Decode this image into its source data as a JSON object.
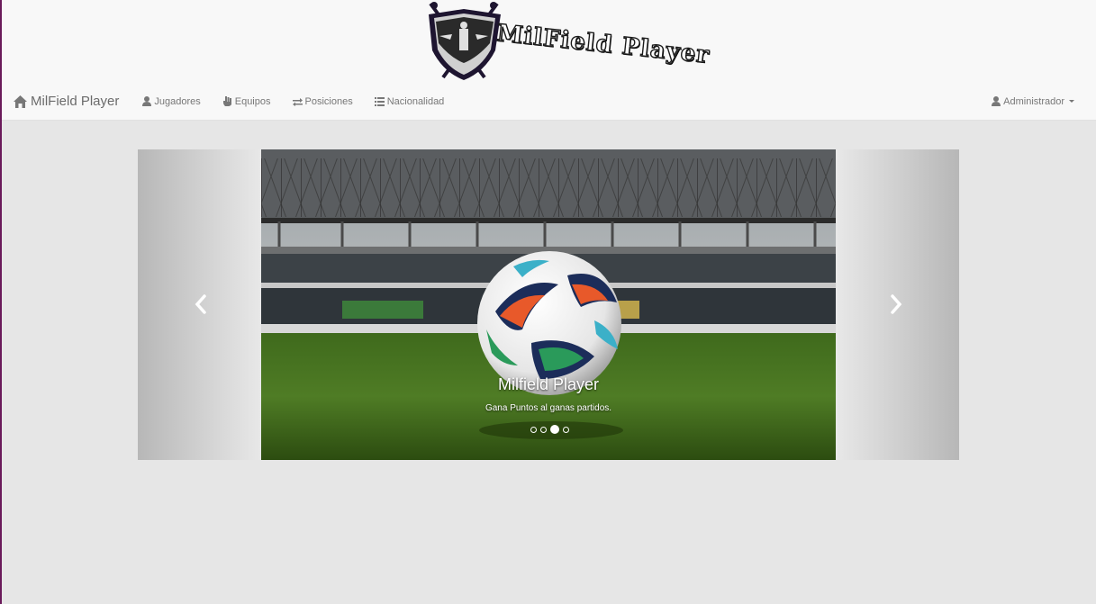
{
  "logo": {
    "text": "MilField Player",
    "shield_text": "MilField Player",
    "colors": {
      "shield": "#1e1530",
      "silver": "#c9c9c9"
    }
  },
  "navbar": {
    "brand": {
      "label": "MilField Player",
      "icon": "home-icon"
    },
    "items": [
      {
        "label": "Jugadores",
        "icon": "user-icon"
      },
      {
        "label": "Equipos",
        "icon": "hand-icon"
      },
      {
        "label": "Posiciones",
        "icon": "transfer-icon"
      },
      {
        "label": "Nacionalidad",
        "icon": "list-icon"
      }
    ],
    "user_menu": {
      "label": "Administrador",
      "icon": "user-icon"
    }
  },
  "carousel": {
    "caption_title": "Milfield Player",
    "caption_text": "Gana Puntos al ganas partidos.",
    "slide_count": 4,
    "active_slide": 3,
    "slide_description": "soccer-ball-on-stadium-grass"
  },
  "colors": {
    "background": "#e6e6e6",
    "navbar": "#f8f8f8",
    "text_muted": "#777777",
    "left_accent": "#6a1a5a"
  }
}
